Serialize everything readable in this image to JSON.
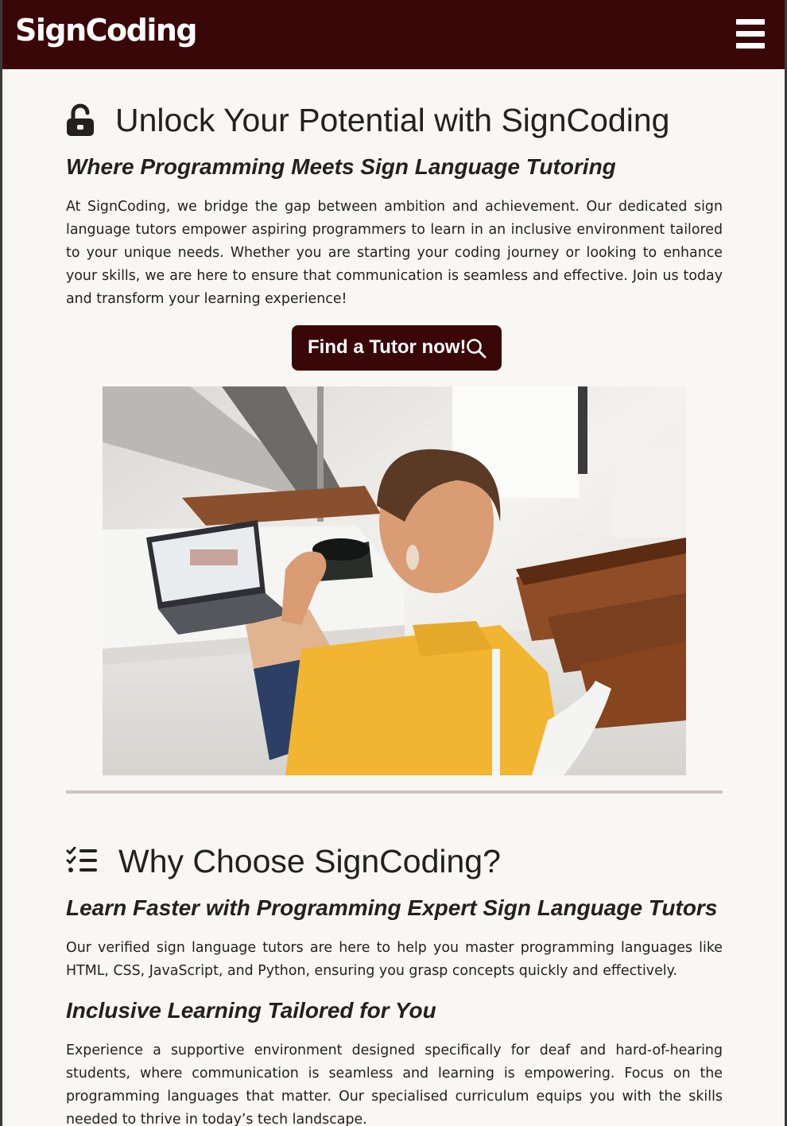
{
  "nav": {
    "brand": "SignCoding",
    "menu_icon": "hamburger-menu-icon"
  },
  "hero": {
    "heading_icon": "unlock-icon",
    "heading": "Unlock Your Potential with SignCoding",
    "subheading": "Where Programming Meets Sign Language Tutoring",
    "paragraph": "At SignCoding, we bridge the gap between ambition and achievement. Our dedicated sign language tutors empower aspiring programmers to learn in an inclusive environment tailored to your unique needs. Whether you are starting your coding journey or looking to enhance your skills, we are here to ensure that communication is seamless and effective. Join us today and transform your learning experience!",
    "cta_label": "Find a Tutor now!",
    "cta_icon": "search-icon"
  },
  "why": {
    "heading_icon": "checklist-icon",
    "heading": "Why Choose SignCoding?",
    "items": [
      {
        "title": "Learn Faster with Programming Expert Sign Language Tutors",
        "text": "Our verified sign language tutors are here to help you master programming languages like HTML, CSS, JavaScript, and Python, ensuring you grasp concepts quickly and effectively."
      },
      {
        "title": "Inclusive Learning Tailored for You",
        "text": "Experience a supportive environment designed specifically for deaf and hard-of-hearing students, where communication is seamless and learning is empowering. Focus on the programming languages that matter. Our specialised curriculum equips you with the skills needed to thrive in today’s tech landscape."
      }
    ]
  },
  "colors": {
    "brand": "#3a0709",
    "background": "#f8f7f4",
    "text": "#23201d",
    "divider": "#d1c3c6"
  }
}
